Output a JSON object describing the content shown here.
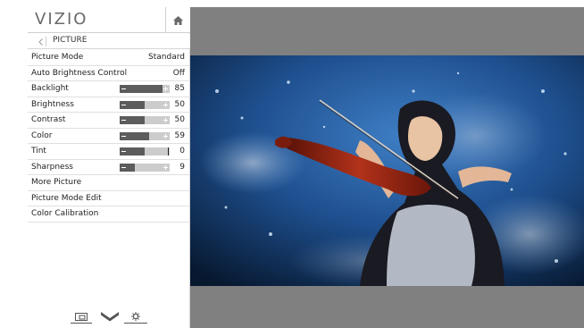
{
  "menu": {
    "brand": "VIZIO",
    "breadcrumb": "PICTURE",
    "items": [
      {
        "label": "Picture Mode",
        "value": "Standard"
      },
      {
        "label": "Auto Brightness Control",
        "value": "Off"
      },
      {
        "label": "Backlight",
        "value": "85",
        "level": 0.85
      },
      {
        "label": "Brightness",
        "value": "50",
        "level": 0.5
      },
      {
        "label": "Contrast",
        "value": "50",
        "level": 0.5
      },
      {
        "label": "Color",
        "value": "59",
        "level": 0.59
      },
      {
        "label": "Tint",
        "value": "0",
        "level": 0.5
      },
      {
        "label": "Sharpness",
        "value": "9",
        "level": 0.3
      },
      {
        "label": "More Picture"
      },
      {
        "label": "Picture Mode Edit"
      },
      {
        "label": "Color Calibration"
      }
    ]
  },
  "icons": {
    "home": "home-icon",
    "back": "back-arrow-icon",
    "screen": "screen-icon",
    "via": "via-v-icon",
    "settings": "gear-icon"
  },
  "colors": {
    "panel_bg": "#ffffff",
    "slider_track": "#cccccc",
    "slider_fill": "#5c5c5c",
    "screen_bg": "#808080"
  }
}
